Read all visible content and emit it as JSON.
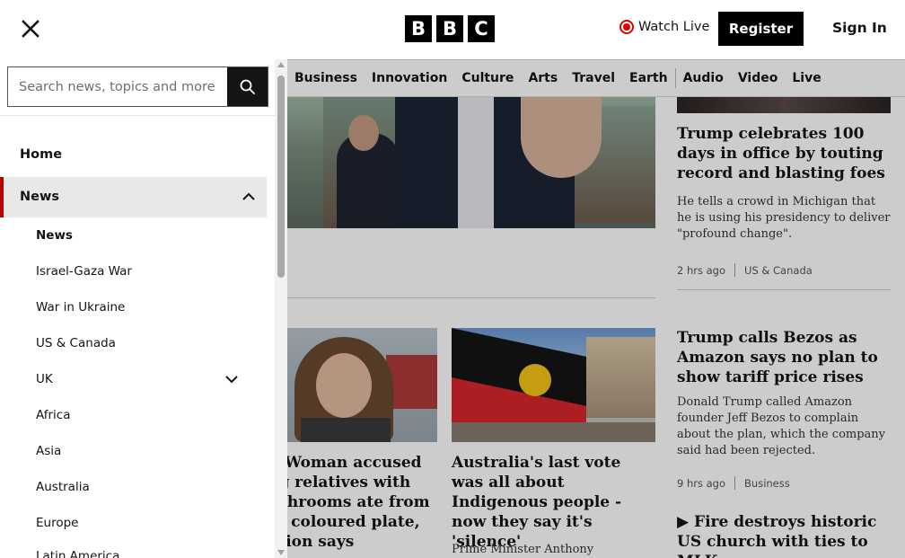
{
  "header": {
    "logo_letters": [
      "B",
      "B",
      "C"
    ],
    "watch_live": "Watch Live",
    "register": "Register",
    "sign_in": "Sign In",
    "accent_color": "#d00000"
  },
  "nav": {
    "items": [
      "Business",
      "Innovation",
      "Culture",
      "Arts",
      "Travel",
      "Earth",
      "Audio",
      "Video",
      "Live"
    ]
  },
  "menu": {
    "search_placeholder": "Search news, topics and more",
    "home": "Home",
    "news": "News",
    "sub_items": [
      "News",
      "Israel-Gaza War",
      "War in Ukraine",
      "US & Canada",
      "UK",
      "Africa",
      "Asia",
      "Australia",
      "Europe",
      "Latin America"
    ],
    "active_color": "#b80000"
  },
  "stories": {
    "trump_100": {
      "headline": "Trump celebrates 100 days in office by touting record and blasting foes",
      "summary": "He tells a crowd in Michigan that he is using his presidency to deliver \"profound change\".",
      "time": "2 hrs ago",
      "section": "US & Canada"
    },
    "bezos": {
      "headline": "Trump calls Bezos as Amazon says no plan to show tariff price rises",
      "summary": "Donald Trump called Amazon founder Jeff Bezos to complain about the plan, which the company said had been rejected.",
      "time": "9 hrs ago",
      "section": "Business"
    },
    "fire": {
      "headline": "Fire destroys historic US church with ties to MLK"
    },
    "woman": {
      "headline": "E Woman accused ng relatives with ushrooms ate from nt coloured plate, ution says"
    },
    "australia": {
      "headline": "Australia's last vote was all about Indigenous people - now they say it's 'silence'",
      "summary": "Prime Minister Anthony"
    }
  }
}
